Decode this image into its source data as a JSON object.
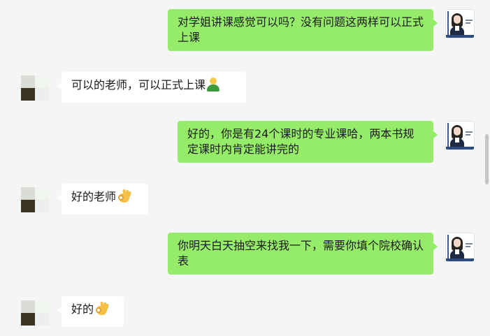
{
  "messages": [
    {
      "side": "out",
      "text": "对学姐讲课感觉可以吗？没有问题这两样可以正式上课",
      "emoji": null
    },
    {
      "side": "in",
      "text": "可以的老师，可以正式上课",
      "emoji": "person-icon"
    },
    {
      "side": "out",
      "text": "好的，你是有24个课时的专业课哈，两本书规定课时内肯定能讲完的",
      "emoji": null
    },
    {
      "side": "in",
      "text": "好的老师",
      "emoji": "ok-hand-icon"
    },
    {
      "side": "out",
      "text": "你明天白天抽空来找我一下，需要你填个院校确认表",
      "emoji": null
    },
    {
      "side": "in",
      "text": "好的",
      "emoji": "ok-hand-icon"
    }
  ],
  "colors": {
    "background": "#f5f5f5",
    "outgoing_bubble": "#95ec69",
    "incoming_bubble": "#ffffff"
  }
}
